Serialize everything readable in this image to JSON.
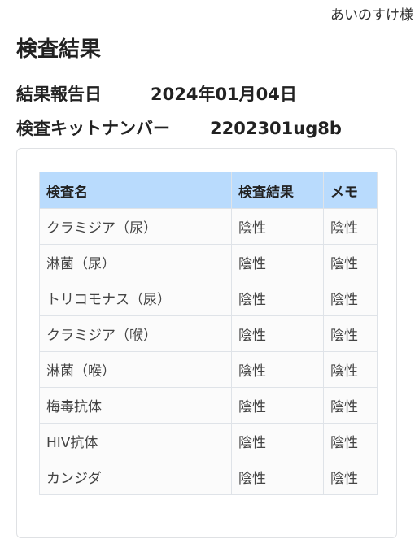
{
  "header": {
    "user_name": "あいのすけ様"
  },
  "page": {
    "title": "検査結果",
    "report_date_label": "結果報告日",
    "report_date_value": "2024年01月04日",
    "kit_number_label": "検査キットナンバー",
    "kit_number_value": "2202301ug8b"
  },
  "results_table": {
    "columns": [
      "検査名",
      "検査結果",
      "メモ"
    ],
    "rows": [
      {
        "name": "クラミジア（尿）",
        "result": "陰性",
        "memo": "陰性"
      },
      {
        "name": "淋菌（尿）",
        "result": "陰性",
        "memo": "陰性"
      },
      {
        "name": "トリコモナス（尿）",
        "result": "陰性",
        "memo": "陰性"
      },
      {
        "name": "クラミジア（喉）",
        "result": "陰性",
        "memo": "陰性"
      },
      {
        "name": "淋菌（喉）",
        "result": "陰性",
        "memo": "陰性"
      },
      {
        "name": "梅毒抗体",
        "result": "陰性",
        "memo": "陰性"
      },
      {
        "name": "HIV抗体",
        "result": "陰性",
        "memo": "陰性"
      },
      {
        "name": "カンジダ",
        "result": "陰性",
        "memo": "陰性"
      }
    ]
  }
}
